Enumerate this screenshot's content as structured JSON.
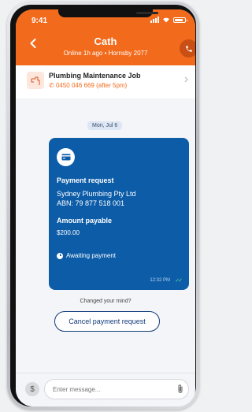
{
  "status_bar": {
    "time": "9:41"
  },
  "header": {
    "contact_name": "Cath",
    "status": "Online 1h ago • Hornsby 2077"
  },
  "job": {
    "title": "Plumbing Maintenance Job",
    "phone": "0450 046 669 (after 5pm)"
  },
  "chat": {
    "date_label": "Mon, Jul 6",
    "payment_message": {
      "title": "Payment request",
      "business_name": "Sydney Plumbing Pty Ltd",
      "abn": "ABN: 79 877 518 001",
      "amount_label": "Amount payable",
      "amount": "$200.00",
      "status": "Awaiting payment",
      "time": "12:32 PM"
    },
    "changed_mind_text": "Changed your mind?",
    "cancel_label": "Cancel payment request"
  },
  "composer": {
    "placeholder": "Enter message...",
    "currency_symbol": "$"
  },
  "colors": {
    "header": "#f26a1b",
    "bubble": "#0c5ca8",
    "button_border": "#123a7a",
    "read_ticks": "#5fe39a"
  }
}
